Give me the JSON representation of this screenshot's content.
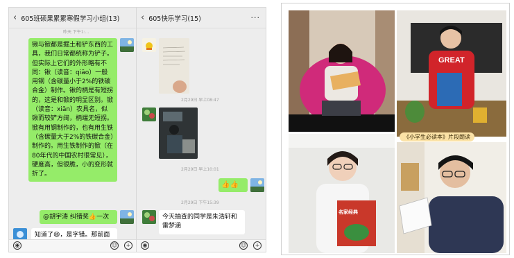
{
  "left_chat": {
    "title": "605班硕果累累寒假学习小组(13)",
    "top_time": "昨天 下午1:...",
    "message1": "锹与锨都是掘土和铲东西的工具，我们日常都统称为铲子。但实际上它们的外形略有不同：锹（读音：qiāo）一般用钢（含碳量小于2%的铁碳合金）制作。锹的柄是有短拐的，这是和锨的明显区别。锨（读音：xiān）农具名，似锹而较铲方阔，柄端无短拐。锨有用钢制作的，也有用生铁（含碳量大于2%的铁碳合金）制作的。用生铁制作的锨（在80年代的中国农村很常见），硬度高，但很脆，小的变形就折了。",
    "message2": "@胡宇涛 纠错奖👍一次",
    "message3": "知道了😄，是字错。那前面"
  },
  "right_chat": {
    "title": "605快乐学习(15)",
    "time1": "2月29日 早上08:47",
    "time2": "2月29日 早上10:01",
    "time3": "2月29日 下午15:39",
    "thumbs": "👍👍",
    "message": "今天抽查的同学是朱浩轩和雷梦涵"
  },
  "photos": {
    "shirt_text": "GREAT",
    "caption": "《小学生必读本》片段朗读",
    "book_title": "名家经典"
  },
  "icons": [
    "back-icon",
    "more-icon",
    "voice-icon",
    "emoji-icon",
    "plus-icon"
  ],
  "colors": {
    "sent_bubble": "#95ec69",
    "chat_bg": "#ededed"
  }
}
